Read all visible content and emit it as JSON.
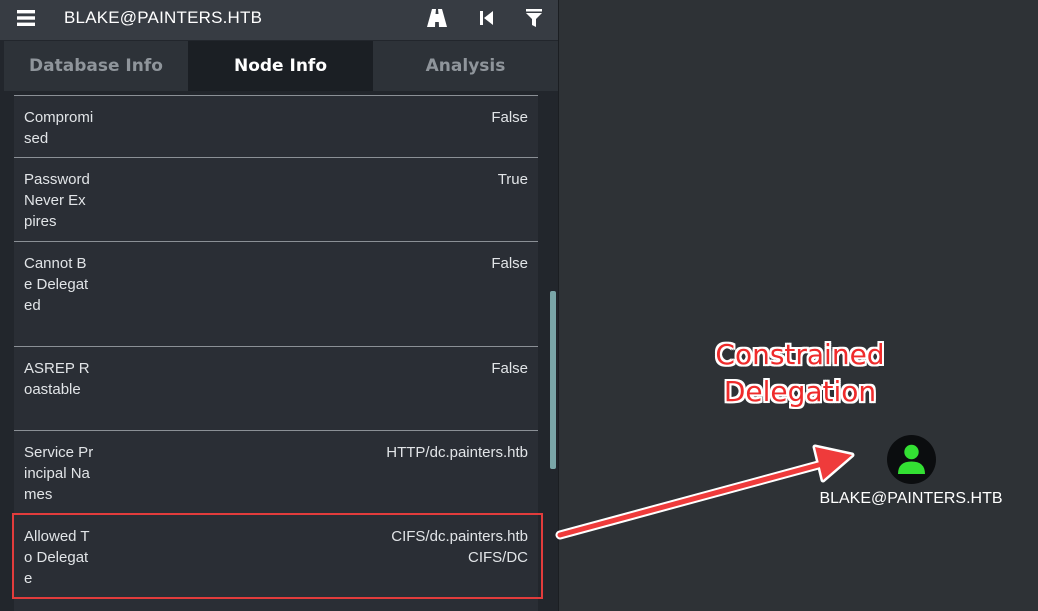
{
  "header": {
    "node_name": "BLAKE@PAINTERS.HTB",
    "icons": [
      "menu-icon",
      "path-finding-icon",
      "back-icon",
      "filter-icon"
    ]
  },
  "tabs": [
    {
      "label": "Database Info",
      "active": false
    },
    {
      "label": "Node Info",
      "active": true
    },
    {
      "label": "Analysis",
      "active": false
    }
  ],
  "properties": [
    {
      "label": "Compromised",
      "value": "False"
    },
    {
      "label": "Password Never Expires",
      "value": "True"
    },
    {
      "label": "Cannot Be Delegated",
      "value": "False"
    },
    {
      "label": "ASREP Roastable",
      "value": "False"
    },
    {
      "label": "Service Principal Names",
      "value": "HTTP/dc.painters.htb"
    },
    {
      "label": "Allowed To Delegate",
      "values": [
        "CIFS/dc.painters.htb",
        "CIFS/DC"
      ]
    }
  ],
  "annotation": {
    "line1": "Constrained",
    "line2": "Delegation",
    "color": "#ef2b2b"
  },
  "graph_node": {
    "label": "BLAKE@PAINTERS.HTB",
    "icon": "user-icon",
    "icon_color": "#33e033"
  }
}
